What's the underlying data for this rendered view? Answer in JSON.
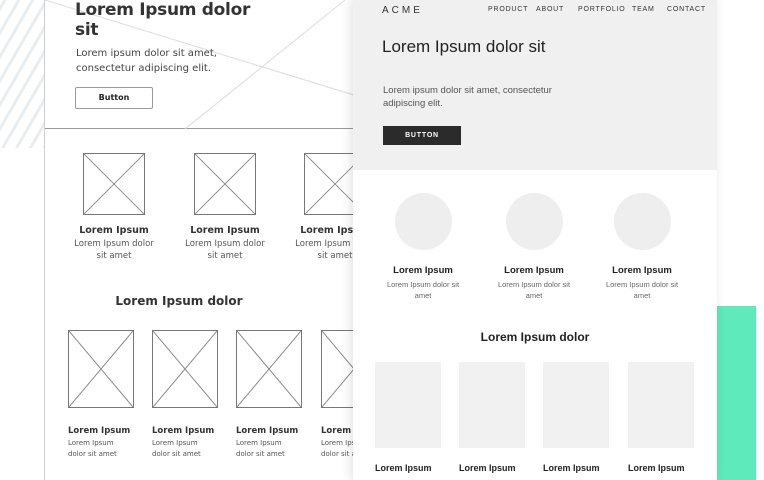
{
  "sketch": {
    "hero": {
      "title": "Lorem Ipsum dolor sit",
      "text": "Lorem ipsum dolor sit amet, consectetur adipiscing elit.",
      "button_label": "Button"
    },
    "cards": [
      {
        "title": "Lorem Ipsum",
        "text": "Lorem Ipsum dolor sit amet"
      },
      {
        "title": "Lorem Ipsum",
        "text": "Lorem Ipsum dolor sit amet"
      },
      {
        "title": "Lorem Ipsum",
        "text": "Lorem Ipsum dolor sit amet"
      }
    ],
    "section_title": "Lorem Ipsum dolor",
    "tiles": [
      {
        "title": "Lorem Ipsum",
        "text": "Lorem Ipsum dolor sit amet"
      },
      {
        "title": "Lorem Ipsum",
        "text": "Lorem Ipsum dolor sit amet"
      },
      {
        "title": "Lorem Ipsum",
        "text": "Lorem Ipsum dolor sit amet"
      },
      {
        "title": "Lorem Ipsum",
        "text": "Lorem Ipsum dolor sit amet"
      }
    ]
  },
  "clean": {
    "logo": "ACME",
    "nav": [
      "PRODUCT",
      "ABOUT",
      "PORTFOLIO",
      "TEAM",
      "CONTACT"
    ],
    "hero": {
      "title": "Lorem Ipsum dolor sit",
      "text": "Lorem ipsum dolor sit amet, consectetur adipiscing elit.",
      "button_label": "BUTTON"
    },
    "cards": [
      {
        "title": "Lorem Ipsum",
        "text": "Lorem Ipsum dolor sit amet"
      },
      {
        "title": "Lorem Ipsum",
        "text": "Lorem Ipsum dolor sit amet"
      },
      {
        "title": "Lorem Ipsum",
        "text": "Lorem Ipsum dolor sit amet"
      }
    ],
    "section_title": "Lorem Ipsum dolor",
    "tiles": [
      {
        "title": "Lorem Ipsum"
      },
      {
        "title": "Lorem Ipsum"
      },
      {
        "title": "Lorem Ipsum"
      },
      {
        "title": "Lorem Ipsum"
      }
    ]
  },
  "colors": {
    "accent_green": "#5eeaba",
    "hero_background": "#f0f0f0",
    "button_dark": "#2b2b2b",
    "placeholder_gray": "#f1f1f1"
  }
}
